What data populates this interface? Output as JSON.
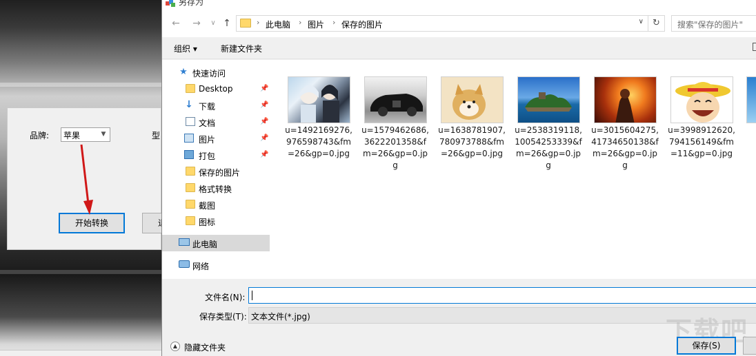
{
  "bg_app": {
    "brand_label": "品牌:",
    "brand_value": "苹果",
    "model_label_cut": "型",
    "start_button": "开始转换",
    "other_button_cut": "退"
  },
  "dialog": {
    "title": "另存为",
    "breadcrumb": [
      "此电脑",
      "图片",
      "保存的图片"
    ],
    "search_placeholder": "搜索\"保存的图片\"",
    "toolbar": {
      "organize": "组织 ▾",
      "new_folder": "新建文件夹"
    },
    "nav_items": [
      {
        "label": "快速访问",
        "icon": "star-icon",
        "pinned": false
      },
      {
        "label": "Desktop",
        "icon": "folder-icon",
        "pinned": true
      },
      {
        "label": "下载",
        "icon": "download-icon",
        "pinned": true
      },
      {
        "label": "文档",
        "icon": "document-icon",
        "pinned": true
      },
      {
        "label": "图片",
        "icon": "pictures-icon",
        "pinned": true
      },
      {
        "label": "打包",
        "icon": "folder-icon",
        "pinned": true
      },
      {
        "label": "保存的图片",
        "icon": "folder-icon",
        "pinned": false
      },
      {
        "label": "格式转换",
        "icon": "folder-icon",
        "pinned": false
      },
      {
        "label": "截图",
        "icon": "folder-icon",
        "pinned": false
      },
      {
        "label": "图标",
        "icon": "folder-icon",
        "pinned": false
      },
      {
        "label": "此电脑",
        "icon": "computer-icon",
        "pinned": false,
        "selected": true
      },
      {
        "label": "网络",
        "icon": "network-icon",
        "pinned": false
      }
    ],
    "files": [
      {
        "name": "u=1492169276,976598743&fm=26&gp=0.jpg",
        "thumb": "anime-characters"
      },
      {
        "name": "u=1579462686,3622201358&fm=26&gp=0.jpg",
        "thumb": "black-sports-car"
      },
      {
        "name": "u=1638781907,780973788&fm=26&gp=0.jpg",
        "thumb": "shiba-dog"
      },
      {
        "name": "u=2538319118,10054253339&fm=26&gp=0.jpg",
        "thumb": "island-sea"
      },
      {
        "name": "u=3015604275,41734650138&fm=26&gp=0.jpg",
        "thumb": "fire-warrior"
      },
      {
        "name": "u=3998912620,794156149&fm=11&gp=0.jpg",
        "thumb": "straw-hat-cartoon"
      }
    ],
    "filename_label": "文件名(N):",
    "filename_value": "",
    "filetype_label": "保存类型(T):",
    "filetype_value": "文本文件(*.jpg)",
    "hide_folders": "隐藏文件夹",
    "save_button": "保存(S)",
    "watermark": "下载吧"
  }
}
